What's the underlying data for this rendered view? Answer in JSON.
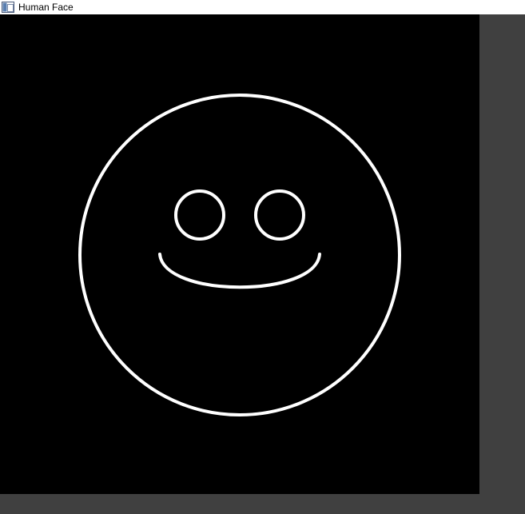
{
  "window": {
    "title": "Human Face",
    "app_icon": "window-app-icon"
  },
  "colors": {
    "titlebar_bg": "#ffffff",
    "canvas_bg": "#000000",
    "window_bg": "#404040",
    "stroke": "#ffffff"
  },
  "drawing": {
    "subject": "smiley-face",
    "parts": [
      "face-outline",
      "left-eye",
      "right-eye",
      "smile-mouth"
    ]
  }
}
